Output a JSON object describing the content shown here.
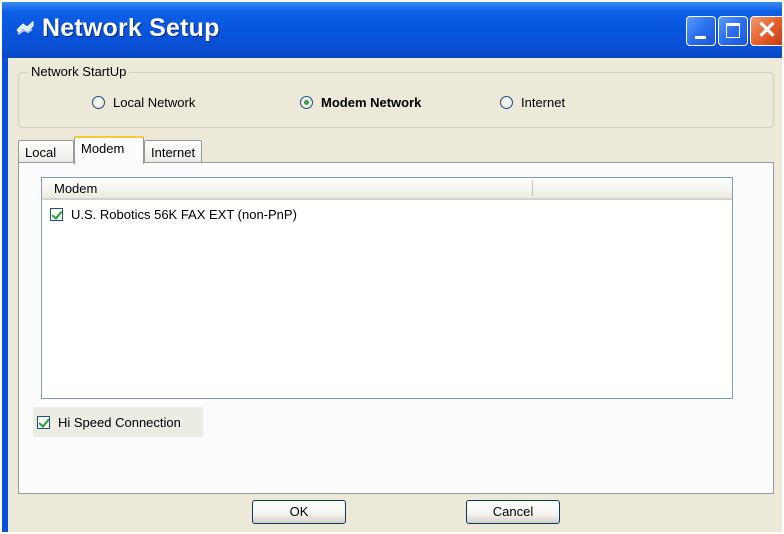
{
  "window": {
    "title": "Network Setup",
    "title_icon": "network-setup-icon",
    "controls": [
      "minimize",
      "maximize",
      "close"
    ]
  },
  "startup": {
    "legend": "Network StartUp",
    "options": [
      {
        "label": "Local Network",
        "selected": false
      },
      {
        "label": "Modem Network",
        "selected": true
      },
      {
        "label": "Internet",
        "selected": false
      }
    ]
  },
  "tabs": [
    {
      "label": "Local",
      "active": false
    },
    {
      "label": "Modem",
      "active": true
    },
    {
      "label": "Internet",
      "active": false
    }
  ],
  "modem_list": {
    "columns": [
      "Modem"
    ],
    "rows": [
      {
        "label": "U.S. Robotics 56K FAX EXT (non-PnP)",
        "checked": true
      }
    ]
  },
  "options": {
    "hi_speed_label": "Hi Speed Connection",
    "hi_speed_checked": true
  },
  "buttons": {
    "ok": "OK",
    "cancel": "Cancel"
  },
  "colors": {
    "titlebar": "#0854dc",
    "client_bg": "#ece9d8",
    "tab_highlight": "#ffc83c",
    "check_green": "#21a121"
  }
}
